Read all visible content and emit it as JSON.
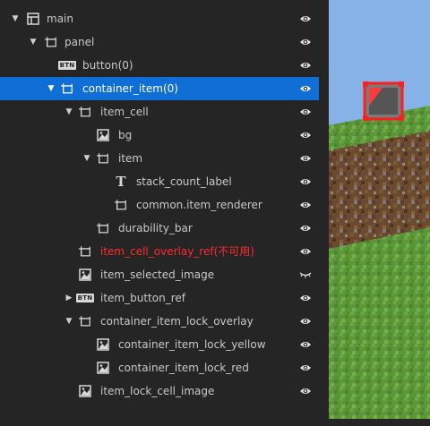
{
  "hierarchy": [
    {
      "label": "main",
      "icon": "canvas-icon",
      "arrow": "down",
      "color": "normal",
      "eye": "visible"
    },
    {
      "label": "panel",
      "icon": "panel-icon",
      "arrow": "down",
      "color": "normal",
      "eye": "visible"
    },
    {
      "label": "button(0)",
      "icon": "button-icon",
      "arrow": "none",
      "color": "normal",
      "eye": "visible"
    },
    {
      "label": "container_item(0)",
      "icon": "panel-icon",
      "arrow": "down",
      "color": "normal",
      "eye": "visible",
      "selected": true
    },
    {
      "label": "item_cell",
      "icon": "panel-icon",
      "arrow": "down",
      "color": "normal",
      "eye": "visible"
    },
    {
      "label": "bg",
      "icon": "image-icon",
      "arrow": "none",
      "color": "normal",
      "eye": "visible"
    },
    {
      "label": "item",
      "icon": "panel-icon",
      "arrow": "down",
      "color": "normal",
      "eye": "visible"
    },
    {
      "label": "stack_count_label",
      "icon": "text-icon",
      "arrow": "none",
      "color": "normal",
      "eye": "visible"
    },
    {
      "label": "common.item_renderer",
      "icon": "panel-icon",
      "arrow": "none",
      "color": "normal",
      "eye": "visible"
    },
    {
      "label": "durability_bar",
      "icon": "panel-icon",
      "arrow": "none",
      "color": "normal",
      "eye": "visible"
    },
    {
      "label": "item_cell_overlay_ref(不可用)",
      "icon": "panel-icon",
      "arrow": "none",
      "color": "error",
      "eye": "visible"
    },
    {
      "label": "item_selected_image",
      "icon": "image-icon",
      "arrow": "none",
      "color": "normal",
      "eye": "hidden"
    },
    {
      "label": "item_button_ref",
      "icon": "button-icon",
      "arrow": "right",
      "color": "normal",
      "eye": "visible"
    },
    {
      "label": "container_item_lock_overlay",
      "icon": "panel-icon",
      "arrow": "down",
      "color": "normal",
      "eye": "visible"
    },
    {
      "label": "container_item_lock_yellow",
      "icon": "image-icon",
      "arrow": "none",
      "color": "normal",
      "eye": "visible"
    },
    {
      "label": "container_item_lock_red",
      "icon": "image-icon",
      "arrow": "none",
      "color": "normal",
      "eye": "visible"
    },
    {
      "label": "item_lock_cell_image",
      "icon": "image-icon",
      "arrow": "none",
      "color": "normal",
      "eye": "visible"
    }
  ],
  "icon_text": {
    "button": "BTN",
    "text": "T"
  },
  "colors": {
    "background": "#252526",
    "selection": "#0f6fd6",
    "error_text": "#ff2b2b",
    "grass": "#4e8a2c",
    "dirt": "#6b4a2e",
    "sky": "#86b2e8",
    "highlight_border": "#ff1f1f"
  }
}
